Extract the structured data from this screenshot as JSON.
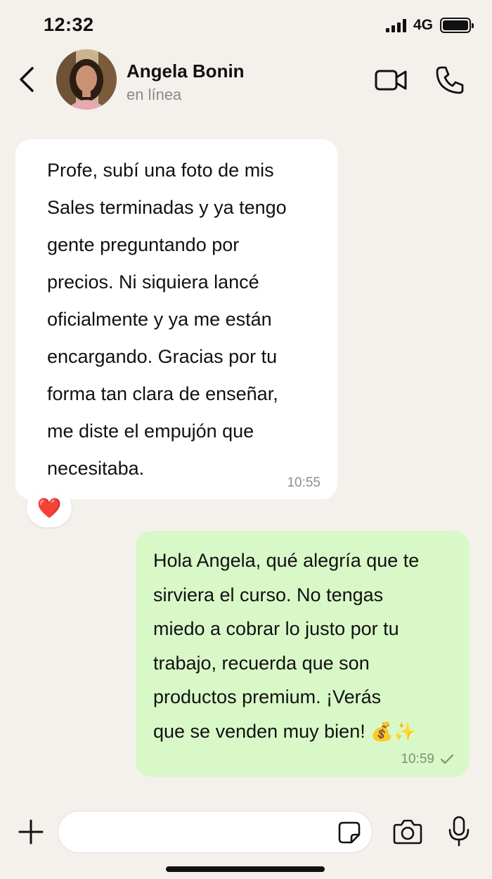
{
  "status_bar": {
    "time": "12:32",
    "network": "4G",
    "icons": [
      "signal-icon",
      "battery-icon"
    ]
  },
  "header": {
    "contact_name": "Angela Bonin",
    "contact_status": "en línea",
    "icons": [
      "back-chevron-icon",
      "video-camera-icon",
      "phone-icon"
    ]
  },
  "messages": [
    {
      "direction": "incoming",
      "lines": [
        "Profe, subí una foto de mis",
        "Sales terminadas y ya tengo",
        "gente preguntando por",
        "precios. Ni siquiera lancé",
        "oficialmente y ya me están",
        "encargando. Gracias por tu",
        "forma tan clara de enseñar,",
        "me diste el empujón que",
        "necesitaba."
      ],
      "time": "10:55",
      "reaction": "❤️"
    },
    {
      "direction": "outgoing",
      "lines": [
        "Hola Angela, qué alegría que te",
        "sirviera el curso. No tengas",
        "miedo a cobrar lo justo por tu",
        "trabajo, recuerda que son",
        "productos premium. ¡Verás",
        "que se venden muy bien!"
      ],
      "emojis": "💰✨",
      "time": "10:59",
      "status_icon": "single-check-icon"
    }
  ],
  "composer": {
    "value": "",
    "icons": [
      "plus-icon",
      "sticker-icon",
      "camera-icon",
      "microphone-icon"
    ]
  },
  "colors": {
    "background": "#f4f1ec",
    "incoming_bubble": "#ffffff",
    "outgoing_bubble": "#d9f8c8",
    "secondary_text": "#8a8a8a"
  }
}
